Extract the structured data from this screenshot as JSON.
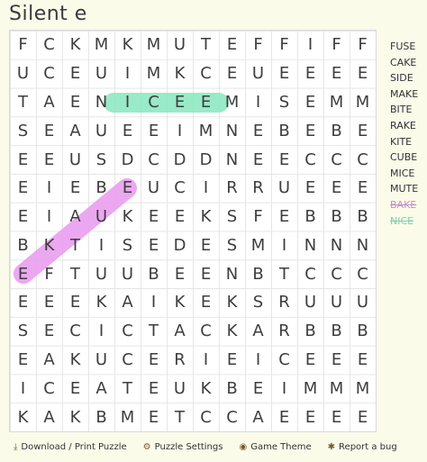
{
  "title": "Silent e",
  "grid": [
    "FCKMKMUTEFFIFF",
    "UCEUIMKCEUEEEE",
    "TAENICEEMISEMM",
    "SEAUEEIMNEBEBE",
    "EEUSDCDDNEECCC",
    "EIEBEUCIRRUEEE",
    "EIAUKEEKSFEBBB",
    "BKTISEDESMINNN",
    "EFTUUBEENBTCCC",
    "EEEKAIKEKSRUUU",
    "SECICTACKARBBB",
    "EAKUCERIEICEEE",
    "ICEATEUKBEIMMM",
    "KAKBMETCCAEEEE"
  ],
  "words": [
    {
      "text": "FUSE",
      "status": "unfound"
    },
    {
      "text": "CAKE",
      "status": "unfound"
    },
    {
      "text": "SIDE",
      "status": "unfound"
    },
    {
      "text": "MAKE",
      "status": "unfound"
    },
    {
      "text": "BITE",
      "status": "unfound"
    },
    {
      "text": "RAKE",
      "status": "unfound"
    },
    {
      "text": "KITE",
      "status": "unfound"
    },
    {
      "text": "CUBE",
      "status": "unfound"
    },
    {
      "text": "MICE",
      "status": "unfound"
    },
    {
      "text": "MUTE",
      "status": "unfound"
    },
    {
      "text": "BAKE",
      "status": "found-pink"
    },
    {
      "text": "NICE",
      "status": "found-green"
    }
  ],
  "highlight_colors": {
    "pink": "#ea9ef0",
    "green": "#8fe8c4"
  },
  "footer": {
    "download": "Download / Print Puzzle",
    "settings": "Puzzle Settings",
    "theme": "Game Theme",
    "bug": "Report a bug"
  },
  "icons": {
    "download": "download-icon",
    "settings": "gear-icon",
    "theme": "eye-icon",
    "bug": "bug-icon"
  }
}
